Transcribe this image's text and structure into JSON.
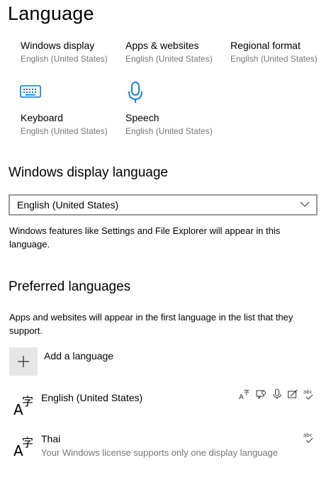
{
  "page": {
    "title": "Language"
  },
  "quick_settings": [
    {
      "title": "Windows display",
      "subtitle": "English (United States)"
    },
    {
      "title": "Apps & websites",
      "subtitle": "English (United States)"
    },
    {
      "title": "Regional format",
      "subtitle": "English (United States)"
    },
    {
      "title": "Keyboard",
      "subtitle": "English (United States)",
      "icon": "keyboard-icon"
    },
    {
      "title": "Speech",
      "subtitle": "English (United States)",
      "icon": "microphone-icon"
    }
  ],
  "display_language": {
    "heading": "Windows display language",
    "selected": "English (United States)",
    "description": "Windows features like Settings and File Explorer will appear in this language."
  },
  "preferred": {
    "heading": "Preferred languages",
    "description": "Apps and websites will appear in the first language in the list that they support.",
    "add_label": "Add a language",
    "languages": [
      {
        "name": "English (United States)",
        "features": [
          "display-language-icon",
          "text-to-speech-icon",
          "speech-icon",
          "handwriting-icon",
          "spellcheck-icon"
        ]
      },
      {
        "name": "Thai",
        "subtitle": "Your Windows license supports only one display language",
        "features": [
          "spellcheck-icon"
        ]
      }
    ]
  },
  "colors": {
    "accent": "#0078d7",
    "secondary_text": "#767676",
    "add_button_bg": "#e6e6e6"
  }
}
